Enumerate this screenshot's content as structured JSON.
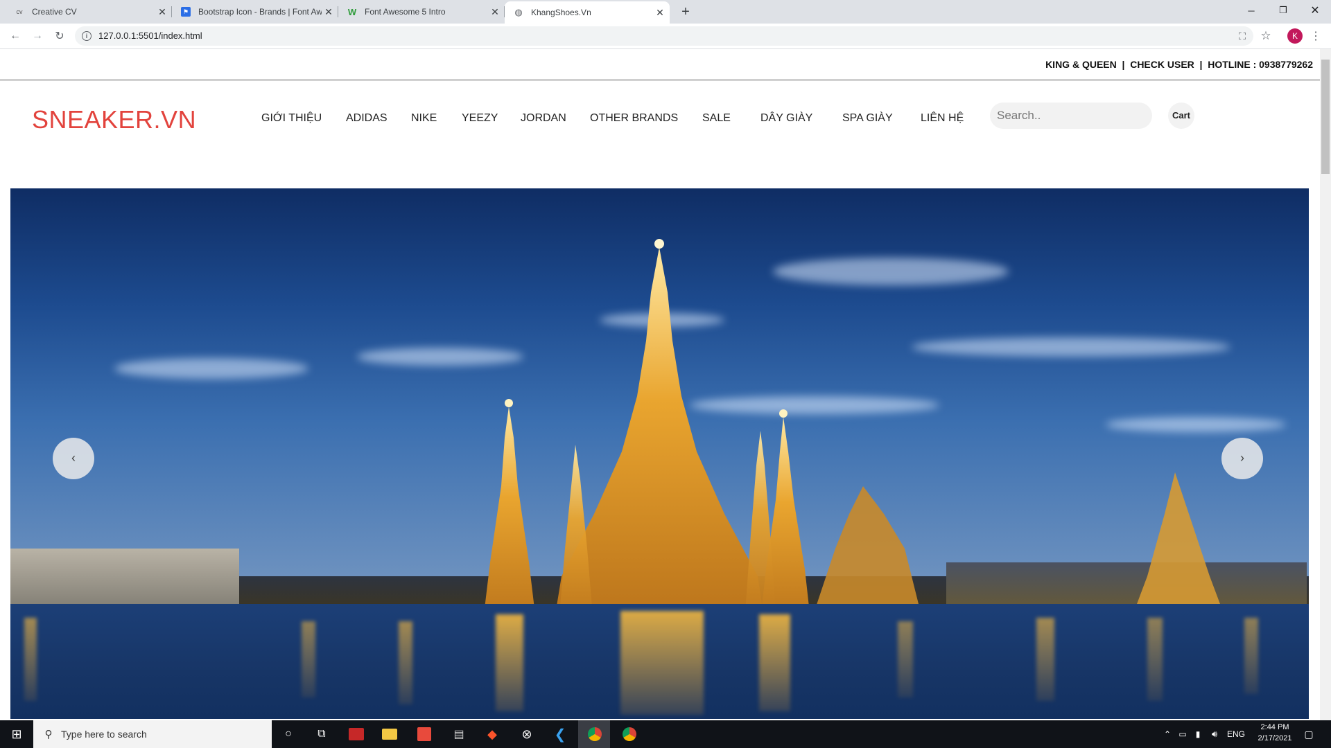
{
  "browser": {
    "tabs": [
      {
        "label": "Creative CV",
        "favicon": "cv"
      },
      {
        "label": "Bootstrap Icon - Brands | Font Aw",
        "favicon": "bootstrap-icon"
      },
      {
        "label": "Font Awesome 5 Intro",
        "favicon": "w3schools-icon"
      },
      {
        "label": "KhangShoes.Vn",
        "favicon": "globe-icon",
        "active": true
      }
    ],
    "new_tab": "+",
    "url": "127.0.0.1:5501/index.html",
    "avatar_letter": "K"
  },
  "page": {
    "top_links": "KING & QUEEN  |  CHECK USER  |  HOTLINE : 0938779262",
    "logo": "SNEAKER.VN",
    "nav": [
      "GIỚI THIỆU",
      "ADIDAS",
      "NIKE",
      "YEEZY",
      "JORDAN",
      "OTHER BRANDS",
      "SALE",
      "DÂY GIÀY",
      "SPA GIÀY",
      "LIÊN HỆ"
    ],
    "search_placeholder": "Search..",
    "cart_label": "Cart",
    "carousel": {
      "prev": "‹",
      "next": "›",
      "image": "wat-arun-temple-night-riverside"
    }
  },
  "taskbar": {
    "search_text": "Type here to search",
    "language": "ENG",
    "time": "2:44 PM",
    "date": "2/17/2021"
  },
  "colors": {
    "logo": "#e2433d",
    "tabstrip": "#dee1e6",
    "taskbar": "#101318"
  }
}
